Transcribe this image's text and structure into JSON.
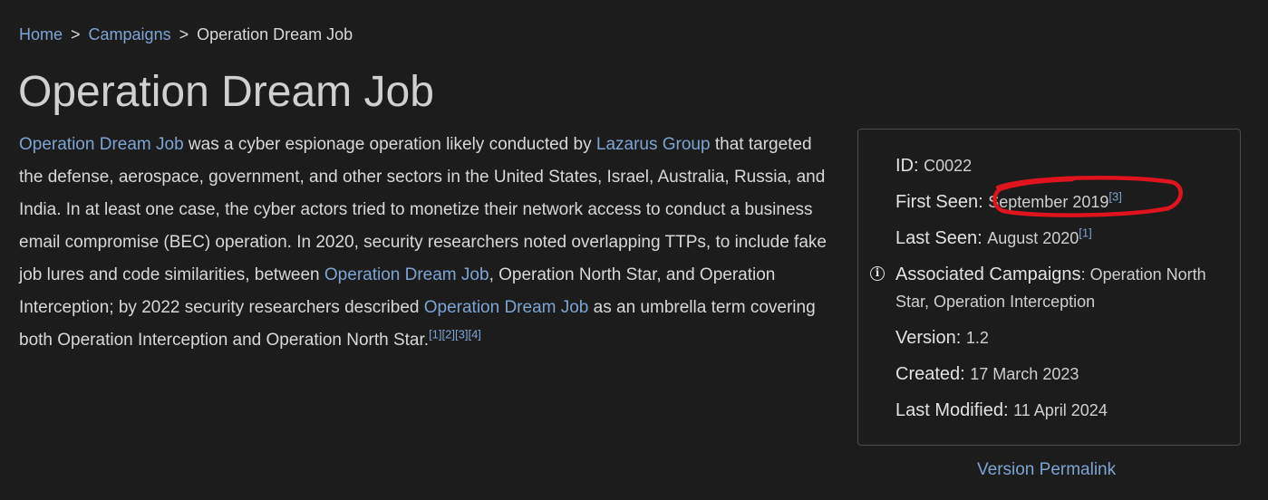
{
  "breadcrumb": {
    "home": "Home",
    "separator": ">",
    "campaigns": "Campaigns",
    "current": "Operation Dream Job"
  },
  "title": "Operation Dream Job",
  "description": {
    "link1": "Operation Dream Job",
    "text1": " was a cyber espionage operation likely conducted by ",
    "link2": "Lazarus Group",
    "text2": " that targeted the defense, aerospace, government, and other sectors in the United States, Israel, Australia, Russia, and India. In at least one case, the cyber actors tried to monetize their network access to conduct a business email compromise (BEC) operation. In 2020, security researchers noted overlapping TTPs, to include fake job lures and code similarities, between ",
    "link3": "Operation Dream Job",
    "text3": ", Operation North Star, and Operation Interception; by 2022 security researchers described ",
    "link4": "Operation Dream Job",
    "text4": " as an umbrella term covering both Operation Interception and Operation North Star.",
    "refs": [
      "[1]",
      "[2]",
      "[3]",
      "[4]"
    ]
  },
  "info": {
    "id_label": "ID:",
    "id_value": "C0022",
    "first_seen_label": "First Seen:",
    "first_seen_value": "September 2019",
    "first_seen_ref": "[3]",
    "last_seen_label": "Last Seen:",
    "last_seen_value": "August 2020",
    "last_seen_ref": "[1]",
    "assoc_label": "Associated Campaigns",
    "assoc_value": ": Operation North Star, Operation Interception",
    "version_label": "Version:",
    "version_value": "1.2",
    "created_label": "Created:",
    "created_value": "17 March 2023",
    "modified_label": "Last Modified:",
    "modified_value": "11 April 2024"
  },
  "permalink": "Version Permalink",
  "colors": {
    "background": "#1c1c1c",
    "link": "#7ea4d4",
    "annotation": "#e0141e"
  },
  "icons": {
    "info": "info-circle-icon"
  }
}
